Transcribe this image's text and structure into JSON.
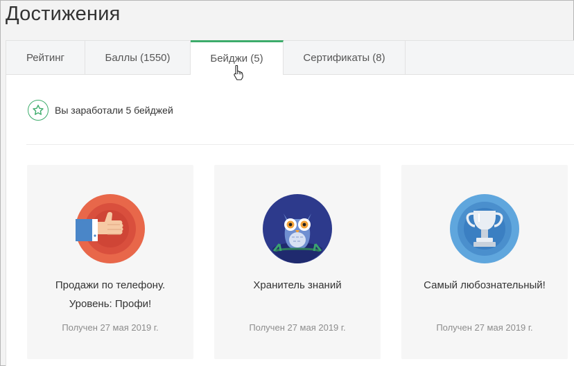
{
  "page": {
    "title": "Достижения"
  },
  "tabs": [
    {
      "label": "Рейтинг"
    },
    {
      "label": "Баллы (1550)"
    },
    {
      "label": "Бейджи (5)"
    },
    {
      "label": "Сертификаты (8)"
    }
  ],
  "active_tab": "Бейджи (5)",
  "earned": {
    "text": "Вы заработали 5 бейджей"
  },
  "badges": [
    {
      "title_line1": "Продажи по телефону.",
      "title_line2": "Уровень: Профи!",
      "date": "Получен 27 мая 2019 г.",
      "icon": "thumbs-up-badge-icon"
    },
    {
      "title_line1": "Хранитель знаний",
      "title_line2": "",
      "date": "Получен 27 мая 2019 г.",
      "icon": "owl-badge-icon"
    },
    {
      "title_line1": "Самый любознательный!",
      "title_line2": "",
      "date": "Получен 27 мая 2019 г.",
      "icon": "trophy-badge-icon"
    }
  ],
  "colors": {
    "accent": "#3dac6b",
    "card_bg": "#f6f6f6"
  }
}
